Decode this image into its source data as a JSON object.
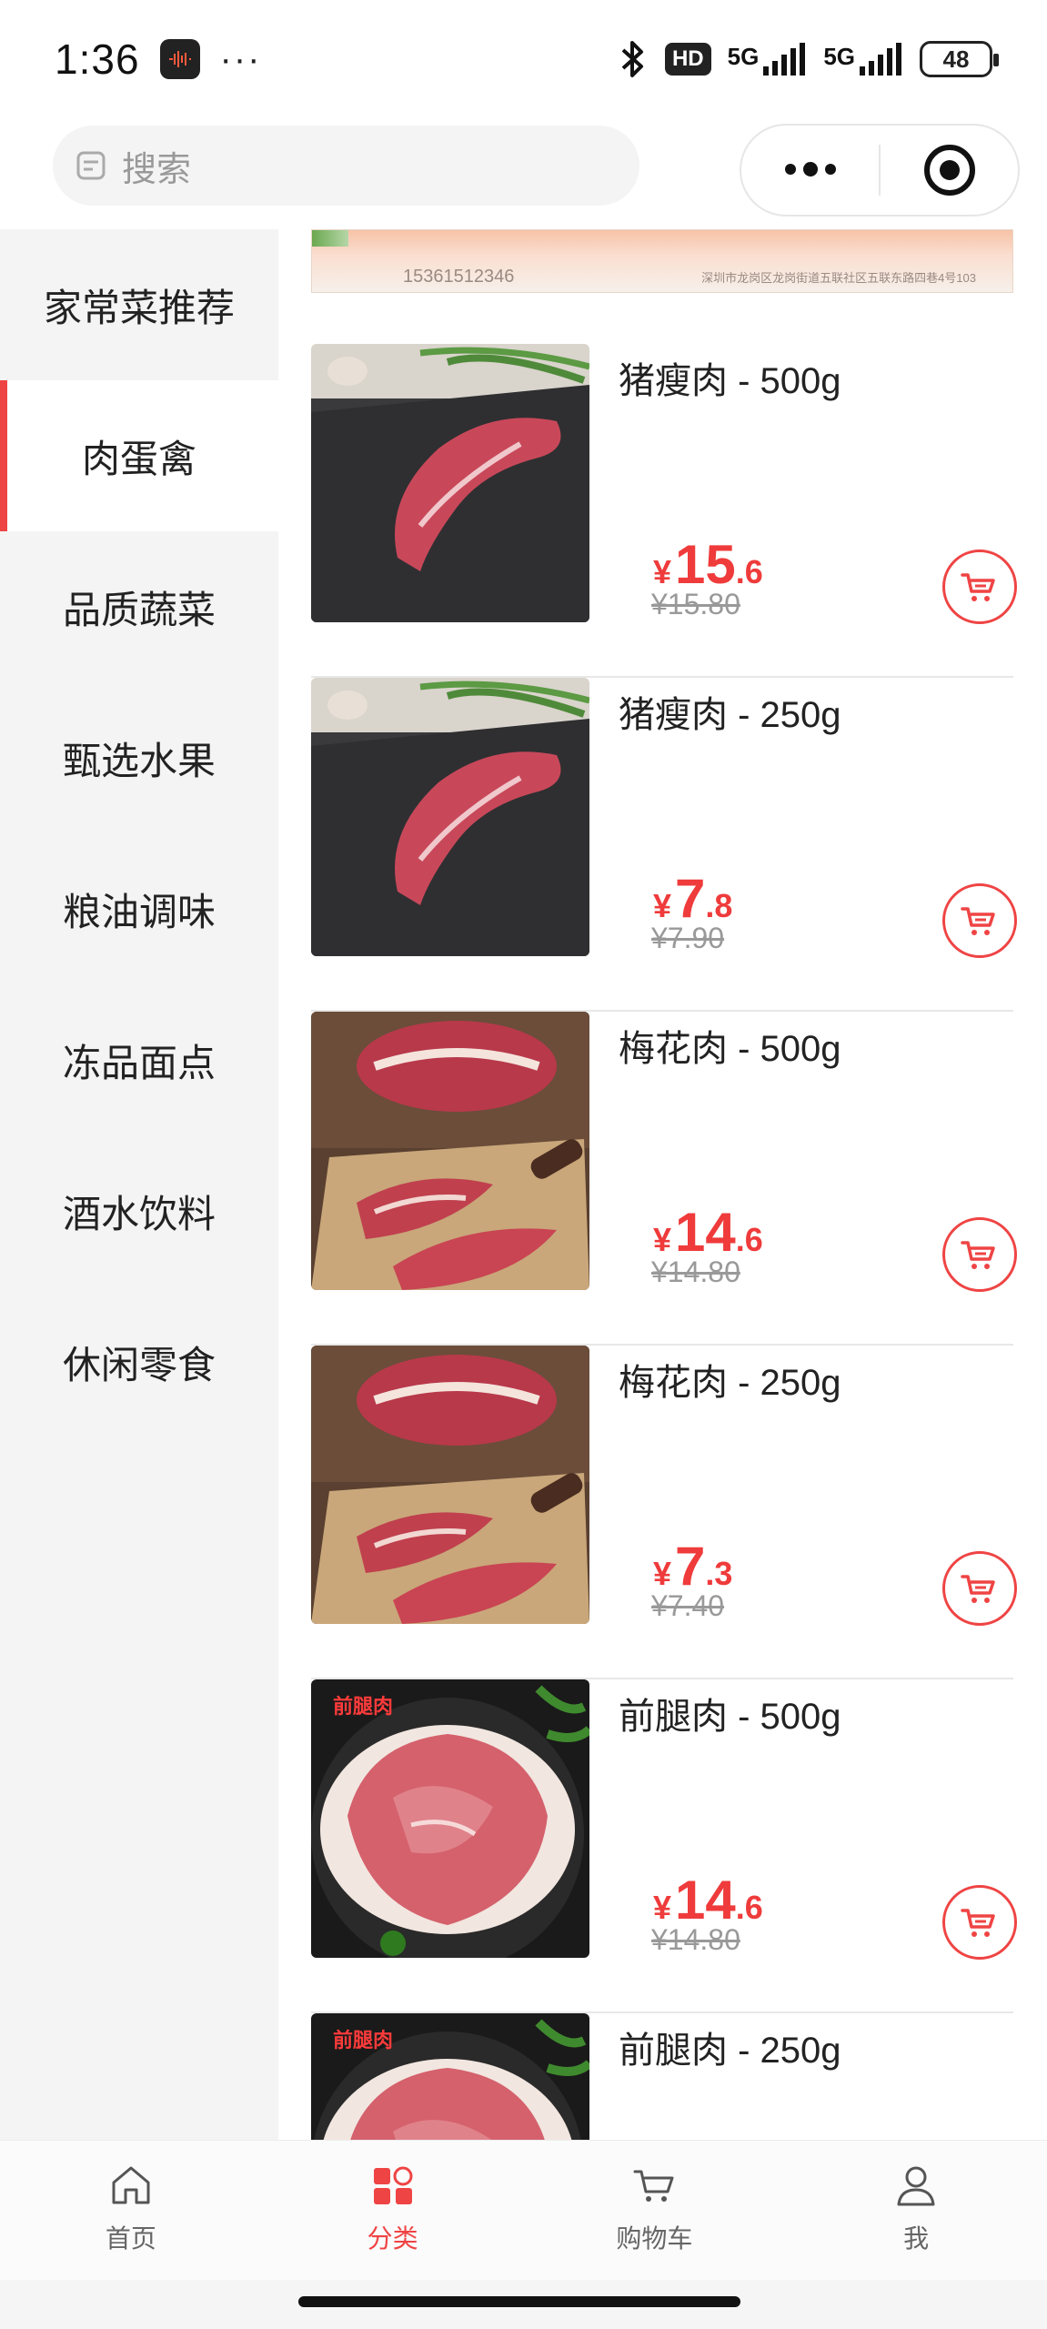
{
  "status_bar": {
    "time": "1:36",
    "more": "···",
    "network1": "5G",
    "network2": "5G",
    "hd_label": "HD",
    "battery": "48"
  },
  "search": {
    "placeholder": "搜索"
  },
  "sidebar": {
    "items": [
      {
        "label": "家常菜推荐"
      },
      {
        "label": "肉蛋禽"
      },
      {
        "label": "品质蔬菜"
      },
      {
        "label": "甄选水果"
      },
      {
        "label": "粮油调味"
      },
      {
        "label": "冻品面点"
      },
      {
        "label": "酒水饮料"
      },
      {
        "label": "休闲零食"
      }
    ],
    "active_index": 1
  },
  "banner": {
    "phone": "15361512346",
    "address": "深圳市龙岗区龙岗街道五联社区五联东路四巷4号103"
  },
  "products": [
    {
      "name": "猪瘦肉 - 500g",
      "currency": "¥",
      "price_int": "15",
      "price_dec": ".6",
      "original_price": "¥15.80",
      "image": "pork-lean"
    },
    {
      "name": "猪瘦肉 - 250g",
      "currency": "¥",
      "price_int": "7",
      "price_dec": ".8",
      "original_price": "¥7.90",
      "image": "pork-lean"
    },
    {
      "name": "梅花肉 - 500g",
      "currency": "¥",
      "price_int": "14",
      "price_dec": ".6",
      "original_price": "¥14.80",
      "image": "pork-collar"
    },
    {
      "name": "梅花肉 - 250g",
      "currency": "¥",
      "price_int": "7",
      "price_dec": ".3",
      "original_price": "¥7.40",
      "image": "pork-collar"
    },
    {
      "name": "前腿肉 - 500g",
      "currency": "¥",
      "price_int": "14",
      "price_dec": ".6",
      "original_price": "¥14.80",
      "image": "pork-foreleg",
      "image_label": "前腿肉"
    },
    {
      "name": "前腿肉 - 250g",
      "currency": "¥",
      "price_int": "",
      "price_dec": "",
      "original_price": "",
      "image": "pork-foreleg",
      "image_label": "前腿肉"
    }
  ],
  "tabbar": {
    "items": [
      {
        "label": "首页",
        "icon": "home-icon"
      },
      {
        "label": "分类",
        "icon": "category-icon"
      },
      {
        "label": "购物车",
        "icon": "cart-icon"
      },
      {
        "label": "我",
        "icon": "user-icon"
      }
    ],
    "active_index": 1
  },
  "colors": {
    "accent": "#ef4444",
    "price": "#ef3b3b",
    "sidebar_bg": "#f4f4f4"
  }
}
